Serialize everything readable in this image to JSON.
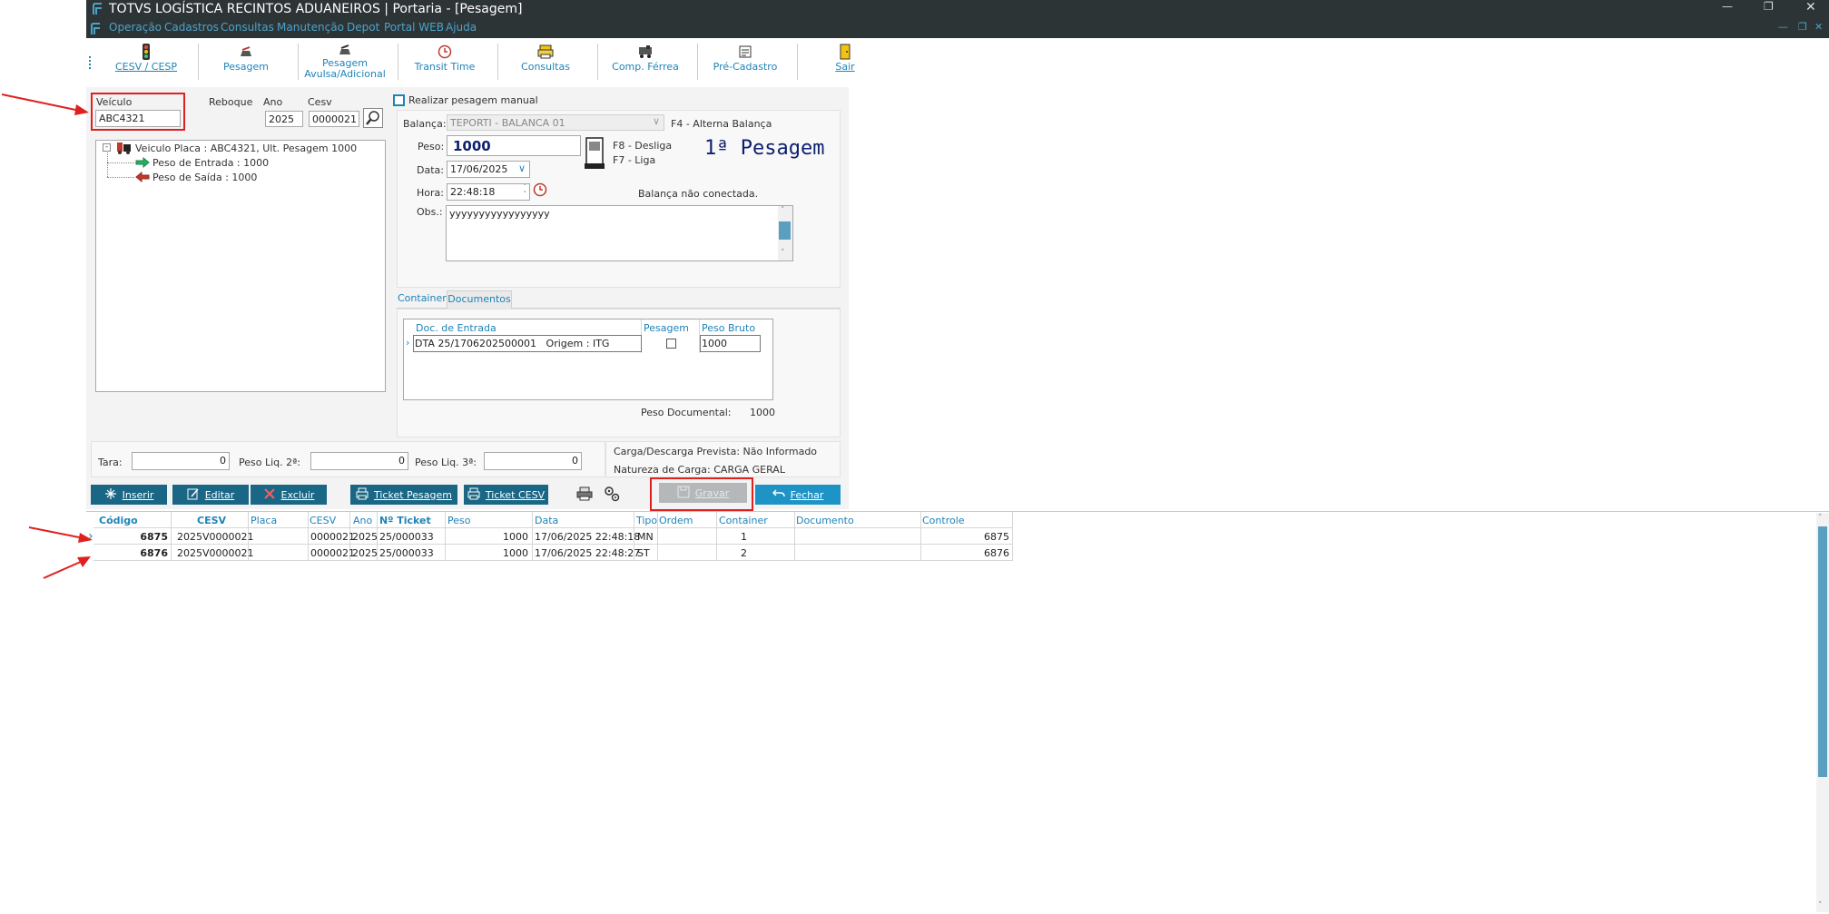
{
  "window": {
    "title": "TOTVS LOGÍSTICA RECINTOS ADUANEIROS | Portaria - [Pesagem]",
    "menu": [
      "Operação",
      "Cadastros",
      "Consultas",
      "Manutenção",
      "Depot",
      "Portal WEB",
      "Ajuda"
    ]
  },
  "toolbar": {
    "buttons": [
      {
        "label": "CESV / CESP",
        "icon": "traffic-light-icon"
      },
      {
        "label": "Pesagem",
        "icon": "scale-icon"
      },
      {
        "label": "Pesagem Avulsa/Adicional",
        "icon": "scale-icon"
      },
      {
        "label": "Transit Time",
        "icon": "clock-icon"
      },
      {
        "label": "Consultas",
        "icon": "printer-icon"
      },
      {
        "label": "Comp. Férrea",
        "icon": "train-icon"
      },
      {
        "label": "Pré-Cadastro",
        "icon": "form-icon"
      },
      {
        "label": "Sair",
        "icon": "door-icon"
      }
    ]
  },
  "vehicle": {
    "veiculo_label": "Veículo",
    "veiculo_value": "ABC4321",
    "reboque_label": "Reboque",
    "ano_label": "Ano",
    "ano_value": "2025",
    "cesv_label": "Cesv",
    "cesv_value": "0000021"
  },
  "tree": {
    "root": "Veiculo Placa : ABC4321, Ult. Pesagem 1000",
    "entrada": "Peso de Entrada : 1000",
    "saida": "Peso de Saída : 1000"
  },
  "weighing": {
    "manual_label": "Realizar pesagem manual",
    "balanca_label": "Balança:",
    "balanca_value": "TEPORTI - BALANCA 01",
    "balanca_hint": "F4 - Alterna Balança",
    "peso_label": "Peso:",
    "peso_value": "1000",
    "f8": "F8 - Desliga",
    "f7": "F7 - Liga",
    "stage": "1ª Pesagem",
    "data_label": "Data:",
    "data_value": "17/06/2025",
    "hora_label": "Hora:",
    "hora_value": "22:48:18",
    "status": "Balança não conectada.",
    "obs_label": "Obs.:",
    "obs_value": "yyyyyyyyyyyyyyyyy"
  },
  "tabs": {
    "container": "Container",
    "documentos": "Documentos"
  },
  "docs": {
    "headers": [
      "Doc. de Entrada",
      "Pesagem",
      "Peso Bruto"
    ],
    "row": {
      "doc": "DTA 25/1706202500001",
      "origem": "Origem : ITG",
      "peso": "1000"
    },
    "peso_doc_label": "Peso Documental:",
    "peso_doc_value": "1000"
  },
  "totals": {
    "tara_label": "Tara:",
    "tara_value": "0",
    "liq2_label": "Peso Liq. 2ª:",
    "liq2_value": "0",
    "liq3_label": "Peso Liq. 3ª:",
    "liq3_value": "0",
    "carga": "Carga/Descarga Prevista: Não Informado",
    "natureza": "Natureza de Carga: CARGA GERAL"
  },
  "actions": {
    "inserir": "Inserir",
    "editar": "Editar",
    "excluir": "Excluir",
    "ticket_pesagem": "Ticket Pesagem",
    "ticket_cesv": "Ticket CESV",
    "gravar": "Gravar",
    "fechar": "Fechar"
  },
  "grid": {
    "headers": [
      "Código",
      "CESV",
      "Placa",
      "CESV",
      "Ano",
      "Nº Ticket",
      "Peso",
      "Data",
      "Tipo",
      "Ordem",
      "Container",
      "Documento",
      "Controle"
    ],
    "rows": [
      [
        "6875",
        "2025V0000021",
        "",
        "0000021",
        "2025",
        "25/000033",
        "1000",
        "17/06/2025 22:48:18",
        "MN",
        "1",
        "",
        "",
        "6875"
      ],
      [
        "6876",
        "2025V0000021",
        "",
        "0000021",
        "2025",
        "25/000033",
        "1000",
        "17/06/2025 22:48:27",
        "ST",
        "2",
        "",
        "",
        "6876"
      ]
    ]
  },
  "colors": {
    "titlebar": "#2d3436",
    "accent": "#1f83b8",
    "button": "#1a6685",
    "annotation": "#e02020"
  }
}
